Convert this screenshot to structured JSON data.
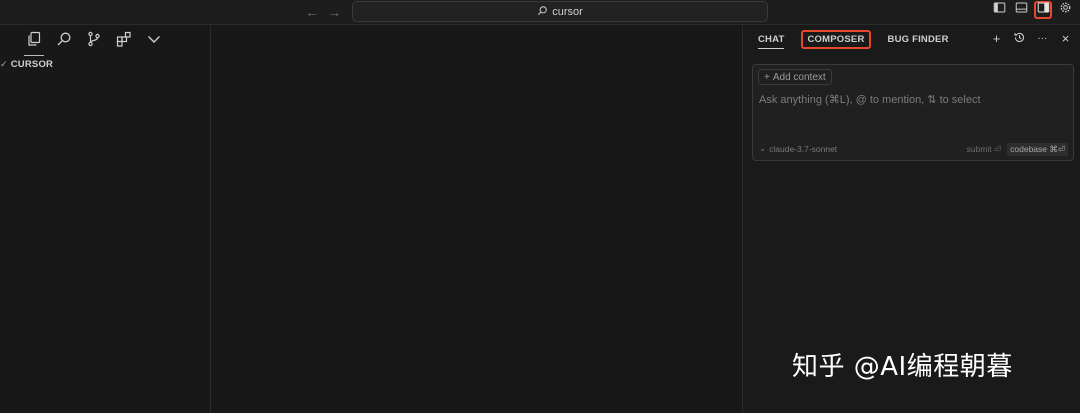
{
  "titlebar": {
    "back_arrow": "←",
    "forward_arrow": "→",
    "search_text": "cursor"
  },
  "sidebar": {
    "root_folder": "CURSOR",
    "root_chevron": "✓"
  },
  "panel": {
    "tabs": [
      {
        "label": "CHAT"
      },
      {
        "label": "COMPOSER"
      },
      {
        "label": "BUG FINDER"
      }
    ],
    "actions": {
      "new": "+",
      "more": "···",
      "close": "×"
    },
    "chat": {
      "add_context": "Add context",
      "add_context_icon": "+",
      "placeholder": "Ask anything (⌘L), @ to mention, ⇅ to select",
      "model_chevron": "⌄",
      "model": "claude-3.7-sonnet",
      "submit": "submit ⏎",
      "codebase": "codebase ⌘⏎"
    }
  },
  "watermark": "知乎 @AI编程朝暮",
  "colors": {
    "highlight": "#e8482c",
    "background": "#181818"
  }
}
